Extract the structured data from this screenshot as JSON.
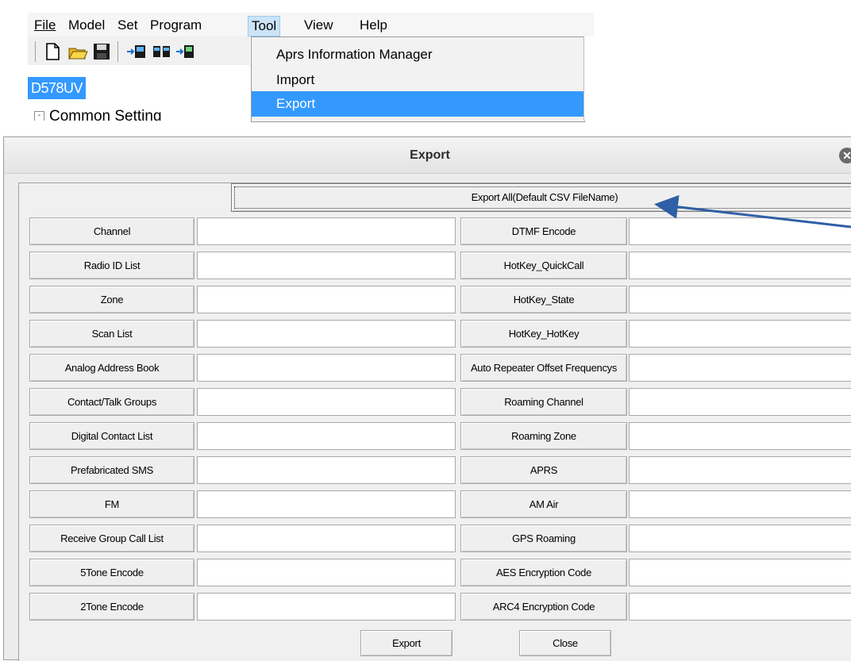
{
  "menubar": {
    "items": [
      "File",
      "Model",
      "Set",
      "Program",
      "Tool",
      "View",
      "Help"
    ],
    "active": "Tool"
  },
  "toolbar": {
    "icons": [
      "new-file-icon",
      "open-folder-icon",
      "save-icon",
      "read-from-radio-icon",
      "program-radio-icon",
      "write-to-radio-icon"
    ]
  },
  "tree": {
    "model": "D578UV",
    "node": "Common Setting",
    "expander": "-"
  },
  "tool_menu": {
    "items": [
      "Aprs Information Manager",
      "Import",
      "Export"
    ],
    "highlighted": "Export"
  },
  "dialog": {
    "title": "Export",
    "export_all": "Export All(Default CSV FileName)",
    "left_items": [
      "Channel",
      "Radio ID List",
      "Zone",
      "Scan List",
      "Analog Address Book",
      "Contact/Talk Groups",
      "Digital Contact List",
      "Prefabricated SMS",
      "FM",
      "Receive Group Call List",
      "5Tone Encode",
      "2Tone Encode"
    ],
    "right_items": [
      "DTMF Encode",
      "HotKey_QuickCall",
      "HotKey_State",
      "HotKey_HotKey",
      "Auto Repeater Offset Frequencys",
      "Roaming Channel",
      "Roaming Zone",
      "APRS",
      "AM Air",
      "GPS Roaming",
      "AES Encryption Code",
      "ARC4 Encryption Code"
    ],
    "field_values_left": [
      "",
      "",
      "",
      "",
      "",
      "",
      "",
      "",
      "",
      "",
      "",
      ""
    ],
    "field_values_right": [
      "",
      "",
      "",
      "",
      "",
      "",
      "",
      "",
      "",
      "",
      "",
      ""
    ],
    "export_button": "Export",
    "close_button": "Close"
  },
  "colors": {
    "selection_blue": "#3399ff",
    "arrow": "#2f5fa6",
    "menu_active": "#cce4f7"
  }
}
